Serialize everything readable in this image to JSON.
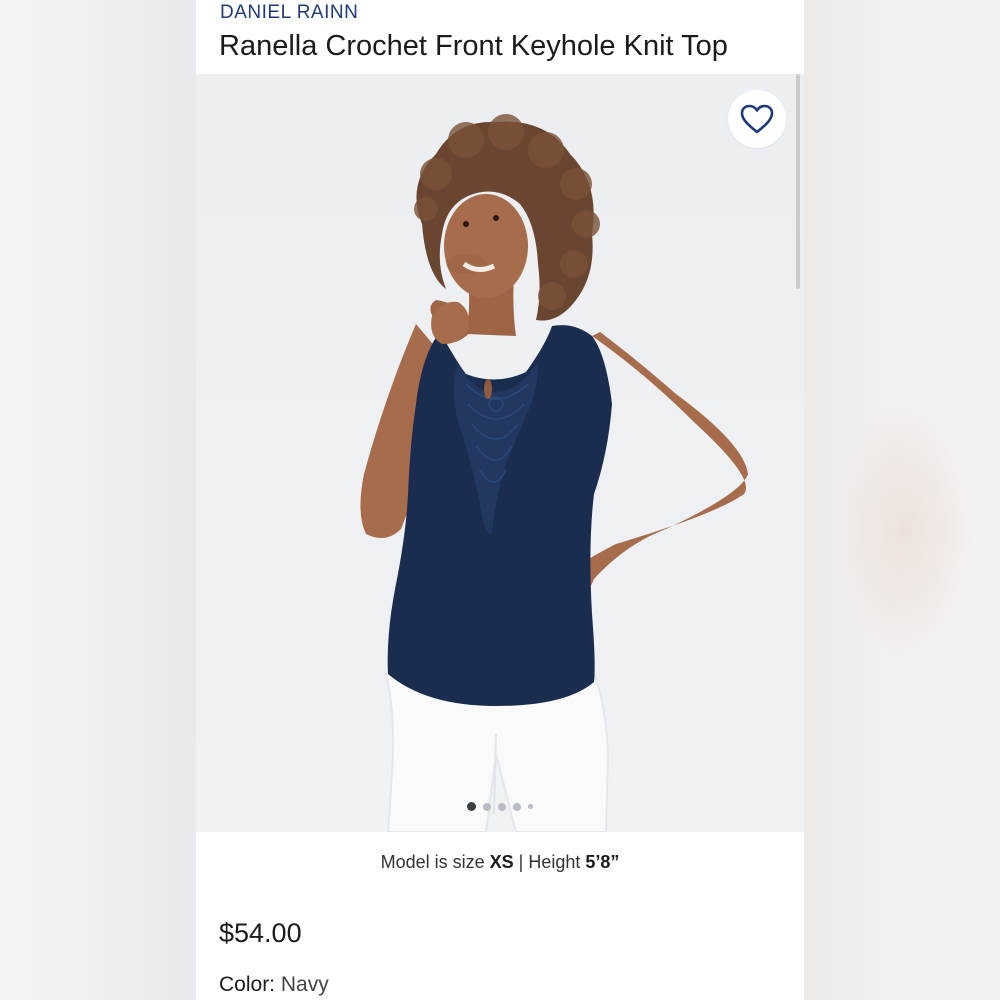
{
  "product": {
    "brand": "DANIEL RAINN",
    "title": "Ranella Crochet Front Keyhole Knit Top",
    "model_size_prefix": "Model is size ",
    "model_size": "XS",
    "model_height_prefix": " | Height ",
    "model_height": "5’8”",
    "price": "$54.00",
    "color_label": "Color:",
    "color_value": "Navy"
  },
  "gallery": {
    "image_alt": "Model wearing navy sleeveless crochet front top with white jeans",
    "dot_count": 5,
    "active_dot": 1
  },
  "icons": {
    "favorite": "heart-icon"
  },
  "colors": {
    "brand": "#1f3a7a",
    "top_navy": "#1b2d4f",
    "text": "#1b1b1b"
  }
}
